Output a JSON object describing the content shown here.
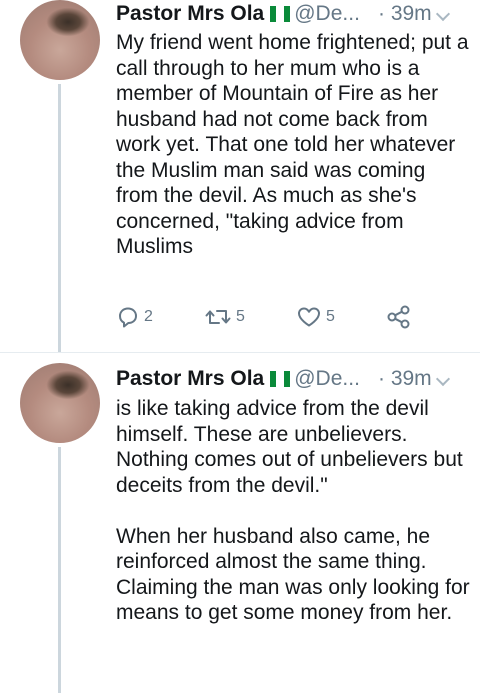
{
  "tweets": [
    {
      "display_name": "Pastor Mrs Ola",
      "handle": "@De...",
      "time": "· 39m",
      "paragraphs": [
        "My friend went home frightened; put a call through to her mum who is a member of Mountain of Fire as her husband had not come back from work yet. That one told her whatever the Muslim man said was coming from the devil. As much as she's concerned, \"taking advice from Muslims"
      ],
      "reply_count": "2",
      "retweet_count": "5",
      "like_count": "5"
    },
    {
      "display_name": "Pastor Mrs Ola",
      "handle": "@De...",
      "time": "· 39m",
      "paragraphs": [
        "is like taking advice from the devil himself. These are unbelievers. Nothing comes out of unbelievers but deceits from the devil.\"",
        "When her husband also came, he reinforced almost the same thing. Claiming the man was only looking for means to get some money from her."
      ]
    }
  ],
  "icons": {
    "reply": "reply-icon",
    "retweet": "retweet-icon",
    "like": "heart-icon",
    "share": "share-icon",
    "flag": "nigeria-flag-icon",
    "menu": "chevron-down-icon"
  },
  "colors": {
    "text": "#14171a",
    "muted": "#657786",
    "thread_line": "#ccd6dd",
    "flag_green": "#0a8a3a"
  }
}
